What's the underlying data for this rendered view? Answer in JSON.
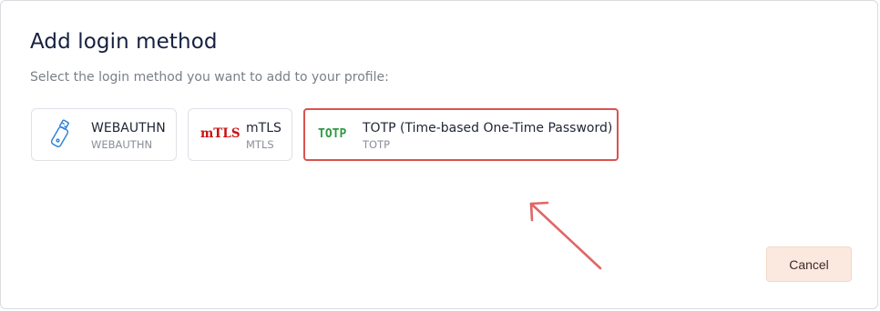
{
  "dialog": {
    "title": "Add login method",
    "subtitle": "Select the login method you want to add to your profile:"
  },
  "methods": [
    {
      "label": "WEBAUTHN",
      "sub": "WEBAUTHN",
      "icon": "usb-key-icon"
    },
    {
      "label": "mTLS",
      "sub": "MTLS",
      "icon_text": "mTLS",
      "icon_color": "#cc1010"
    },
    {
      "label": "TOTP (Time-based One-Time Password)",
      "sub": "TOTP",
      "icon_text": "TOTP",
      "icon_color": "#2e9a40",
      "selected": true
    }
  ],
  "annotation": {
    "arrow_color": "#e06666",
    "highlight_color": "#d9534f"
  },
  "buttons": {
    "cancel": "Cancel"
  }
}
